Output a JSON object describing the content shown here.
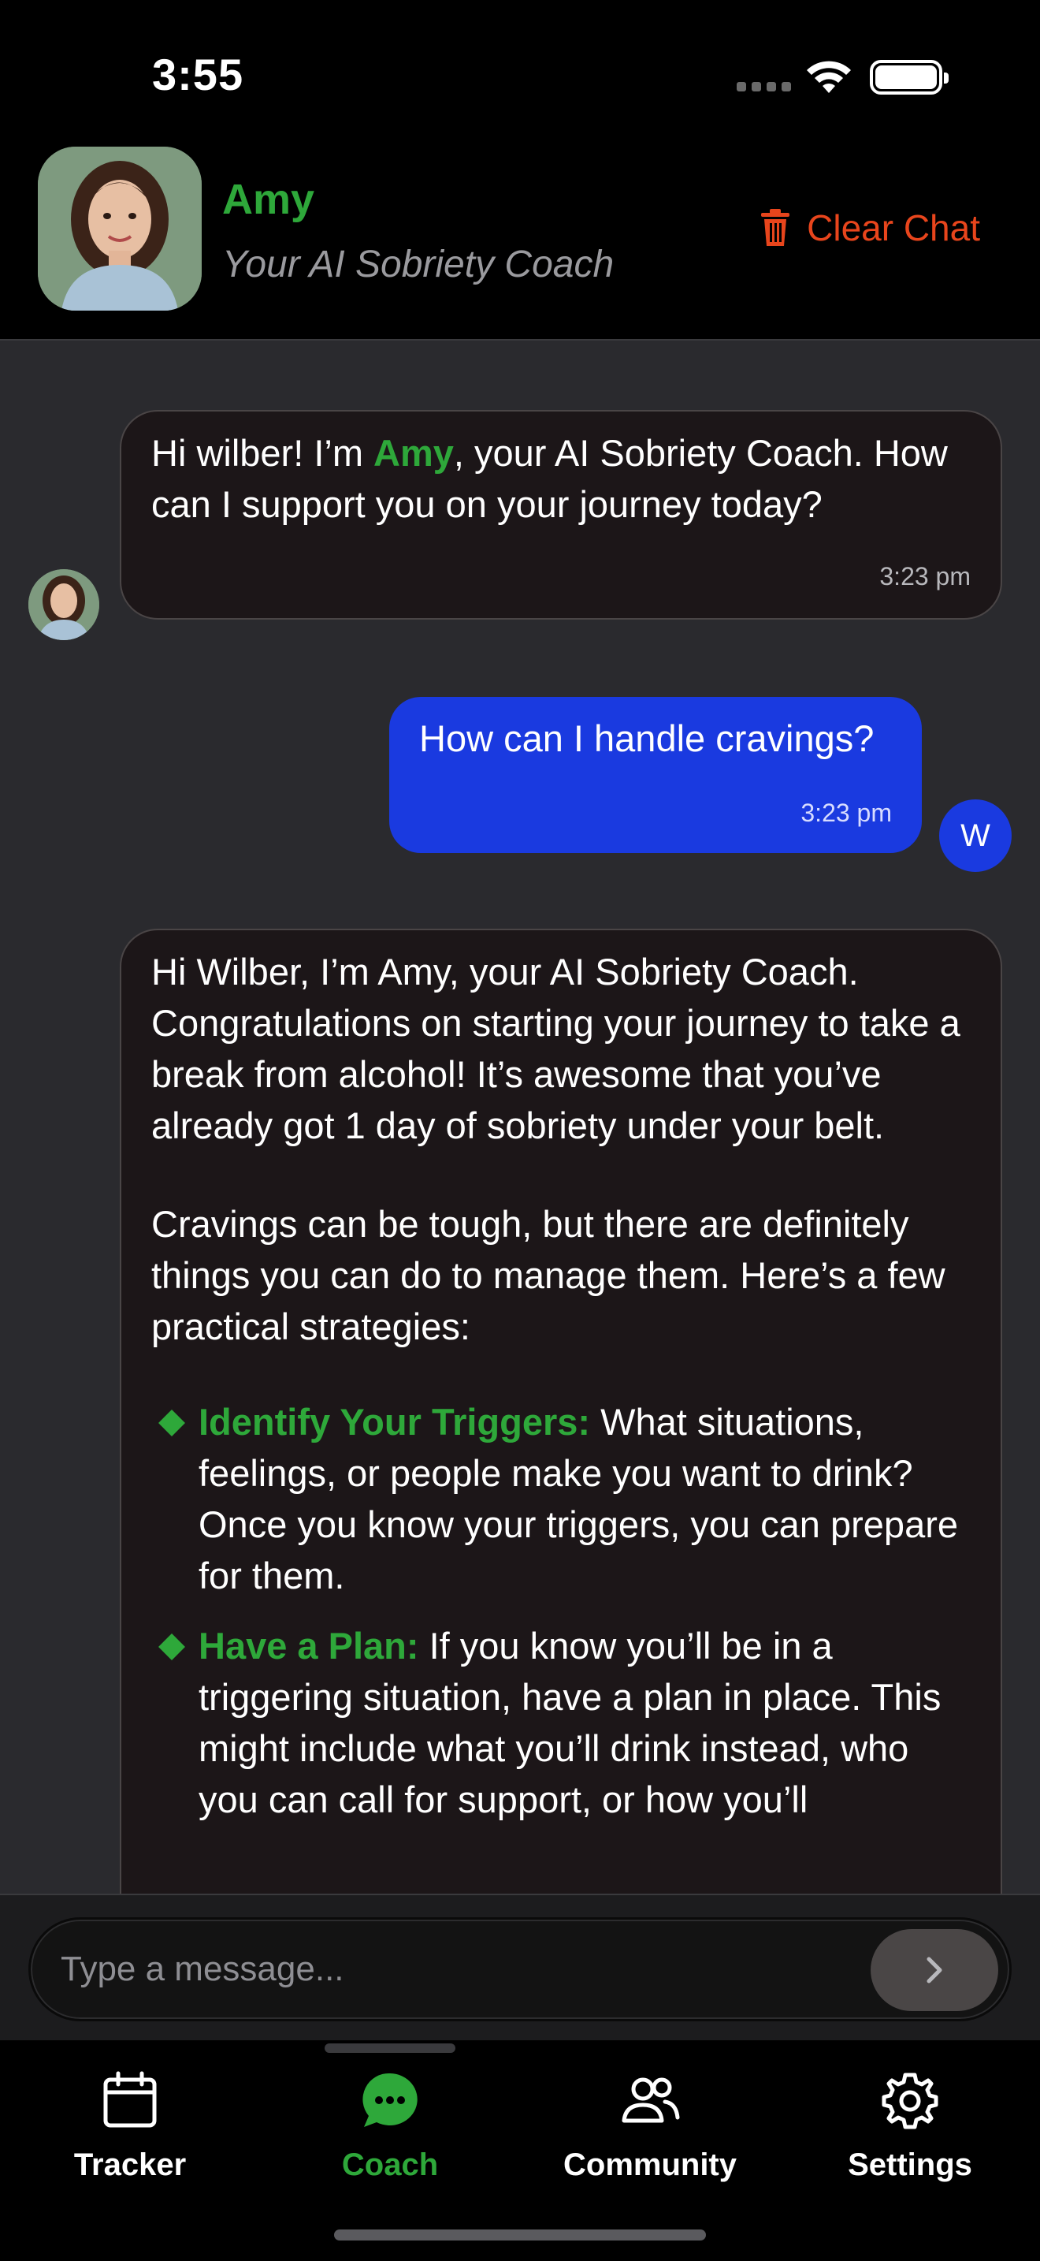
{
  "status_bar": {
    "time": "3:55"
  },
  "header": {
    "coach_name": "Amy",
    "coach_subtitle": "Your AI Sobriety Coach",
    "clear_chat_label": "Clear Chat",
    "clear_chat_icon": "trash-icon"
  },
  "messages": [
    {
      "sender": "ai",
      "text_before": "Hi wilber! I’m ",
      "highlight": "Amy",
      "text_after": ", your AI Sobriety Coach. How can I support you on your journey today?",
      "time": "3:23 pm"
    },
    {
      "sender": "user",
      "text": "How can I handle cravings?",
      "time": "3:23 pm",
      "avatar_initial": "W"
    },
    {
      "sender": "ai",
      "paragraph_1": "Hi Wilber, I’m Amy, your AI Sobriety Coach. Congratulations on starting your journey to take a break from alcohol! It’s awesome that you’ve already got 1 day of sobriety under your belt.",
      "paragraph_2": "Cravings can be tough, but there are definitely things you can do to manage them. Here’s a few practical strategies:",
      "bullets": [
        {
          "title": "Identify Your Triggers:",
          "text": " What situations, feelings, or people make you want to drink? Once you know your triggers, you can prepare for them."
        },
        {
          "title": "Have a Plan:",
          "text": " If you know you’ll be in a triggering situation, have a plan in place. This might include what you’ll drink instead, who you can call for support, or how you’ll"
        }
      ]
    }
  ],
  "input": {
    "placeholder": "Type a message..."
  },
  "tabs": [
    {
      "label": "Tracker",
      "icon": "calendar-icon",
      "active": false
    },
    {
      "label": "Coach",
      "icon": "chat-bubble-icon",
      "active": true
    },
    {
      "label": "Community",
      "icon": "people-icon",
      "active": false
    },
    {
      "label": "Settings",
      "icon": "gear-icon",
      "active": false
    }
  ],
  "colors": {
    "accent_green": "#2ea83a",
    "user_bubble": "#1a3ae0",
    "danger": "#e8451c"
  }
}
